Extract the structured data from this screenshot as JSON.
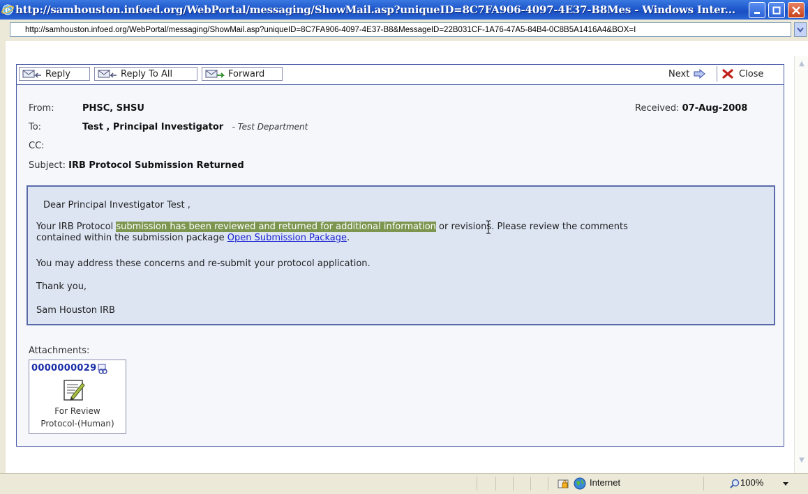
{
  "window": {
    "title": "http://samhouston.infoed.org/WebPortal/messaging/ShowMail.asp?uniqueID=8C7FA906-4097-4E37-B8Mes - Windows Inter...",
    "address": "http://samhouston.infoed.org/WebPortal/messaging/ShowMail.asp?uniqueID=8C7FA906-4097-4E37-B8&MessageID=22B031CF-1A76-47A5-84B4-0C8B5A1416A4&BOX=I"
  },
  "toolbar": {
    "reply": "Reply",
    "reply_all": "Reply To All",
    "forward": "Forward",
    "next": "Next",
    "close": "Close"
  },
  "header": {
    "from_label": "From:",
    "from_value": "PHSC, SHSU",
    "received_label": "Received:",
    "received_value": "07-Aug-2008",
    "to_label": "To:",
    "to_value": "Test , Principal Investigator",
    "to_dept": "- Test Department",
    "cc_label": "CC:",
    "subject_label": "Subject:",
    "subject_value": "IRB Protocol Submission Returned"
  },
  "message": {
    "greeting": "Dear Principal Investigator Test ,",
    "line1_pre": "Your IRB Protocol ",
    "line1_highlight": "submission has been reviewed and returned for additional information",
    "line1_post": " or revisions. Please review the comments",
    "line2_pre": "contained within the submission package ",
    "line2_link": "Open Submission Package",
    "line2_post": ".",
    "line3": "You may address these concerns and re-submit your protocol application.",
    "closing": "Thank you,",
    "signature": "Sam Houston IRB"
  },
  "attachments": {
    "label": "Attachments:",
    "items": [
      {
        "id": "0000000029",
        "line1": "For Review",
        "line2": "Protocol-(Human)"
      }
    ]
  },
  "statusbar": {
    "zone": "Internet",
    "zoom": "100%"
  },
  "colors": {
    "titlebar": "#1f58cc",
    "panel_border": "#4a5ca6",
    "message_bg": "#dde5f3",
    "highlight": "#7c9650",
    "link": "#1a24d0"
  },
  "icons": [
    "ie-icon",
    "minimize-icon",
    "maximize-icon",
    "close-window-icon",
    "reply-icon",
    "reply-all-icon",
    "forward-icon",
    "next-arrow-icon",
    "close-x-icon",
    "download-icon",
    "document-icon",
    "lock-icon",
    "globe-icon",
    "zoom-icon",
    "text-cursor-icon"
  ]
}
